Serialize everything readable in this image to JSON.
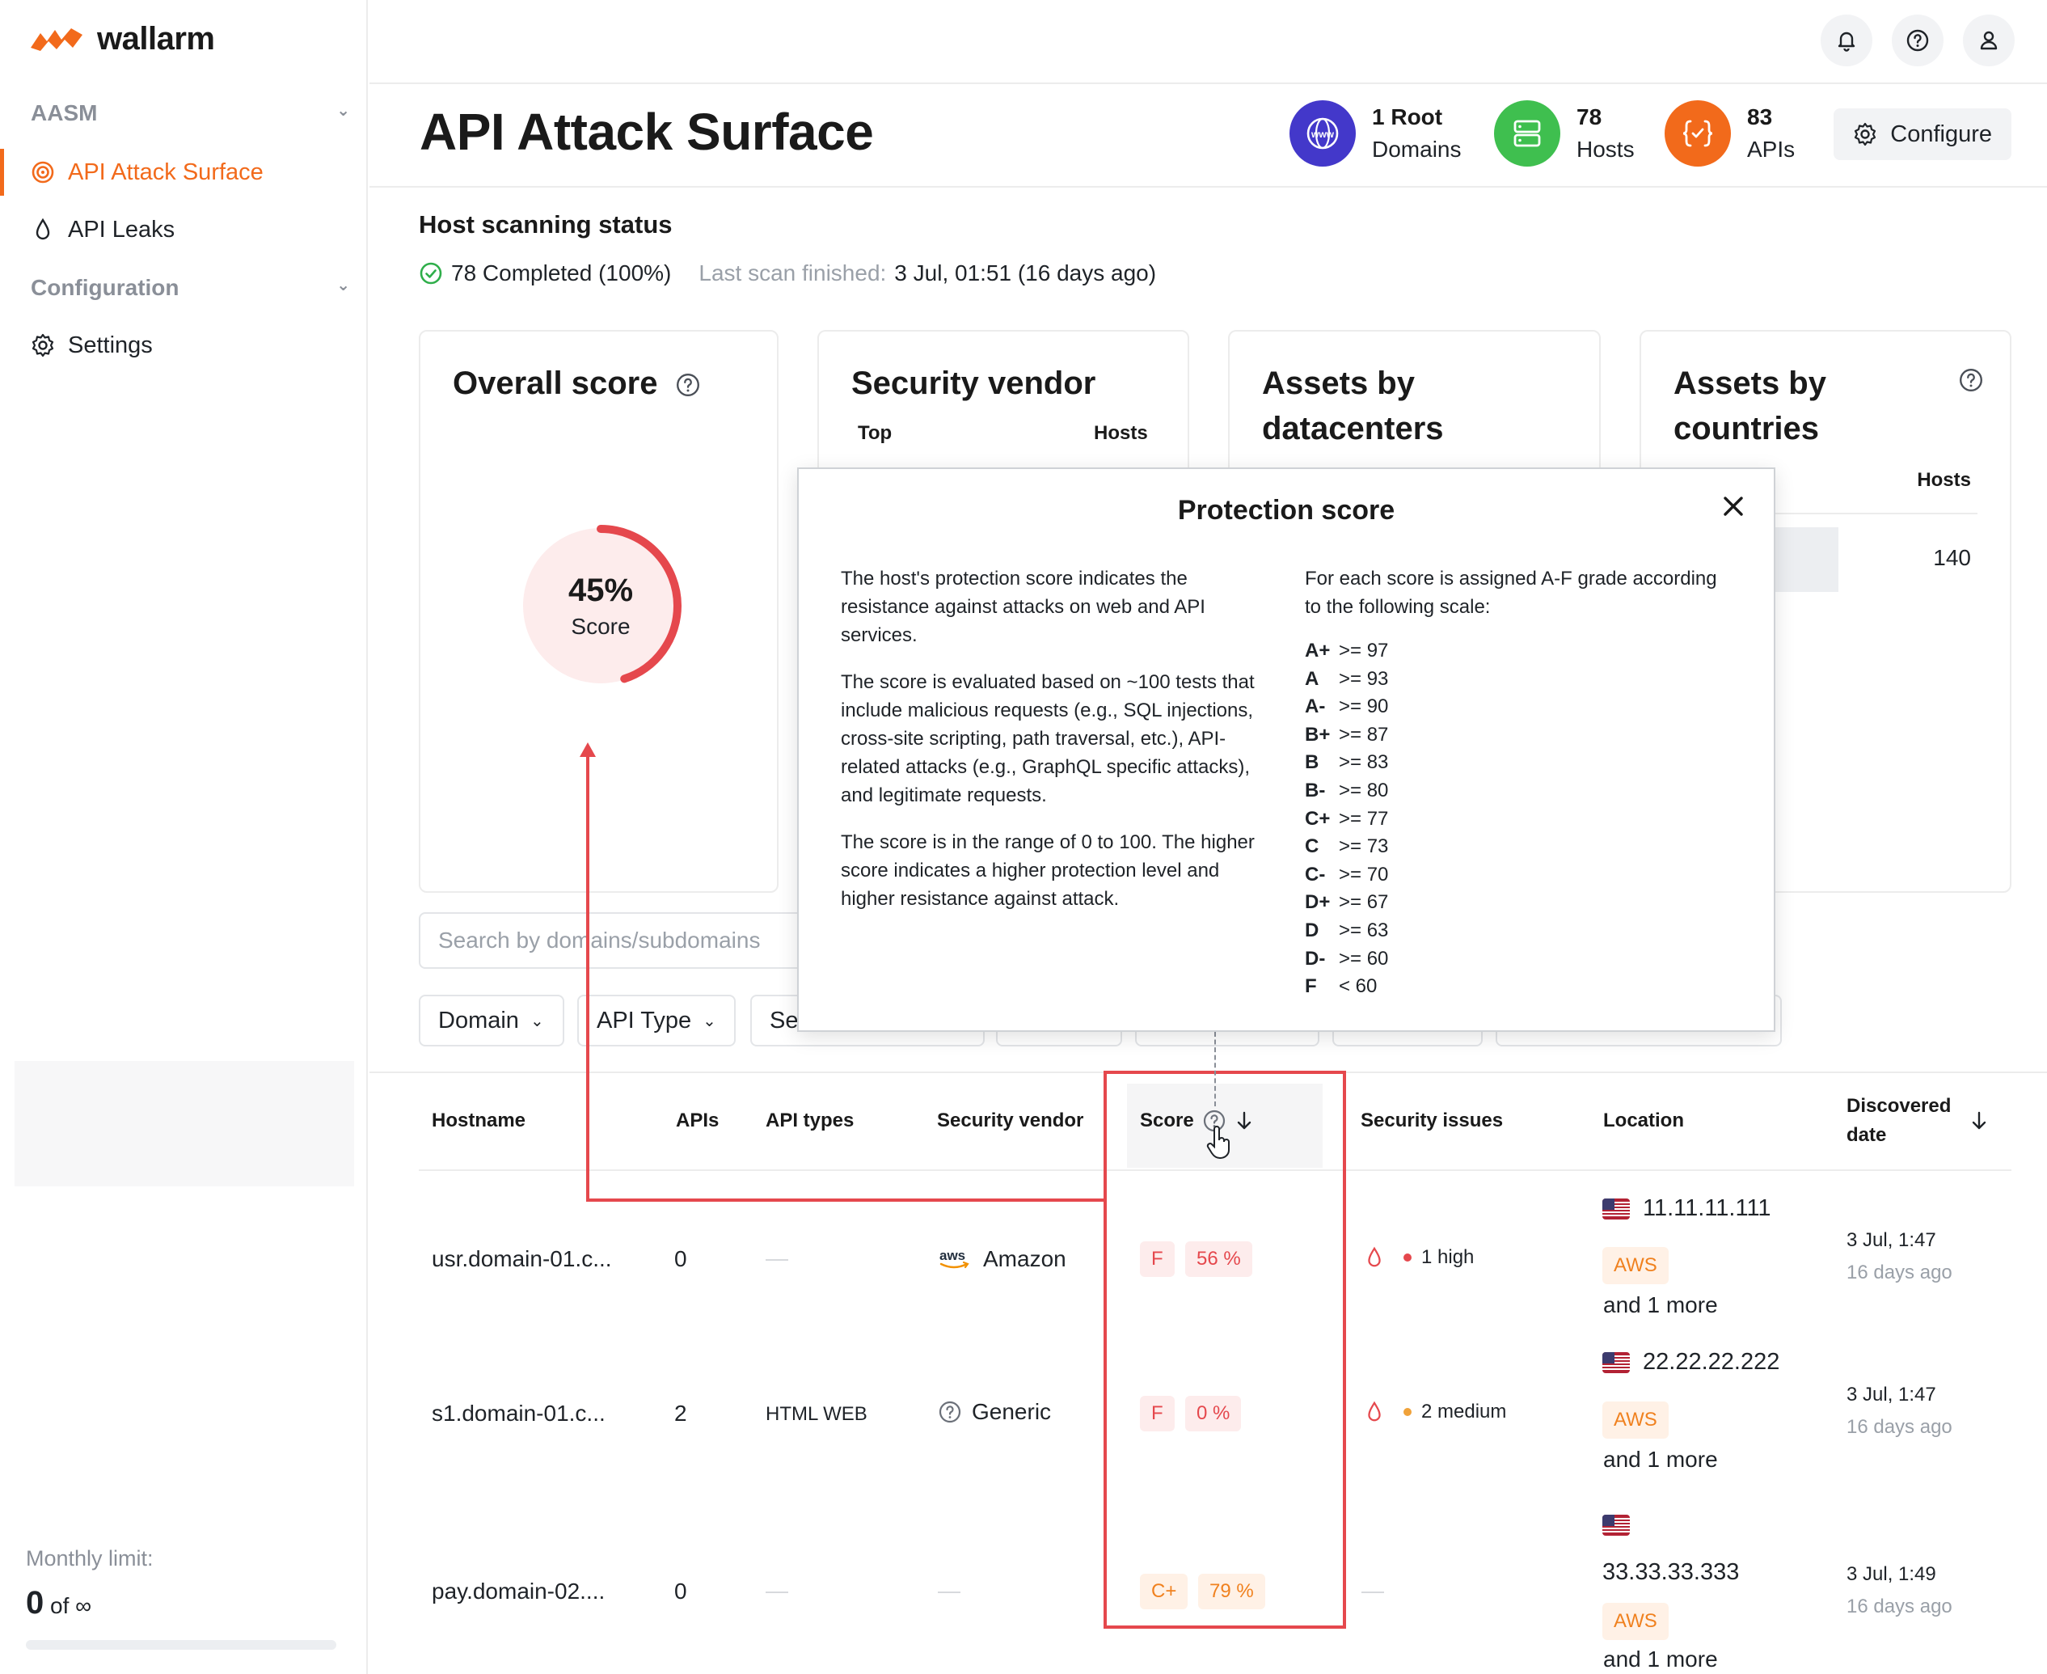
{
  "brand": {
    "name": "wallarm",
    "accent": "#f26a1b"
  },
  "sidebar": {
    "group_aasm": "AASM",
    "items_aasm": [
      {
        "label": "API Attack Surface",
        "icon": "target-icon",
        "active": true
      },
      {
        "label": "API Leaks",
        "icon": "drop-icon",
        "active": false
      }
    ],
    "group_config": "Configuration",
    "items_config": [
      {
        "label": "Settings",
        "icon": "gear-icon"
      }
    ],
    "monthly_limit_label": "Monthly limit:",
    "monthly_limit_value": "0",
    "monthly_limit_of": "of ∞"
  },
  "topbar": {
    "icons": [
      "bell-icon",
      "help-icon",
      "user-icon"
    ]
  },
  "header": {
    "title": "API Attack Surface",
    "stats": [
      {
        "num": "1 Root",
        "label": "Domains",
        "icon": "www-icon",
        "color": "#4338ca"
      },
      {
        "num": "78",
        "label": "Hosts",
        "icon": "server-icon",
        "color": "#3fbf4f"
      },
      {
        "num": "83",
        "label": "APIs",
        "icon": "api-braces-icon",
        "color": "#f26a1b"
      }
    ],
    "configure_label": "Configure"
  },
  "scan": {
    "title": "Host scanning status",
    "completed": "78 Completed (100%)",
    "last_label": "Last scan finished:",
    "last_value": "3 Jul, 01:51 (16 days ago)"
  },
  "cards": {
    "overall_title": "Overall score",
    "overall_value": "45%",
    "overall_label": "Score",
    "overall_fraction": 0.45,
    "vendor_title": "Security vendor",
    "vendor_col_top": "Top",
    "vendor_col_hosts": "Hosts",
    "datacenters_title_1": "Assets by",
    "datacenters_title_2": "datacenters",
    "countries_title_1": "Assets by",
    "countries_title_2": "countries",
    "countries_col_hosts": "Hosts",
    "countries_value": "140"
  },
  "search": {
    "placeholder": "Search by domains/subdomains"
  },
  "filters": [
    {
      "label": "Domain"
    },
    {
      "label": "API Type"
    },
    {
      "label": "Se"
    }
  ],
  "table": {
    "headers": {
      "hostname": "Hostname",
      "apis": "APIs",
      "api_types": "API types",
      "vendor": "Security vendor",
      "score": "Score",
      "issues": "Security issues",
      "location": "Location",
      "discovered_1": "Discovered",
      "discovered_2": "date"
    },
    "rows": [
      {
        "hostname": "usr.domain-01.c...",
        "apis": "0",
        "api_types": "",
        "vendor": "Amazon",
        "vendor_icon": "aws-icon",
        "grade": "F",
        "score": "56 %",
        "issue": "1 high",
        "issue_color": "#e5484d",
        "ip": "11.11.11.111",
        "tag": "AWS",
        "more": "and 1 more",
        "date": "3 Jul, 1:47",
        "ago": "16 days ago"
      },
      {
        "hostname": "s1.domain-01.c...",
        "apis": "2",
        "api_types": "HTML WEB",
        "vendor": "Generic",
        "vendor_icon": "question-circle-icon",
        "grade": "F",
        "score": "0 %",
        "issue": "2 medium",
        "issue_color": "#f0a23a",
        "ip": "22.22.22.222",
        "tag": "AWS",
        "more": "and 1 more",
        "date": "3 Jul, 1:47",
        "ago": "16 days ago"
      },
      {
        "hostname": "pay.domain-02....",
        "apis": "0",
        "api_types": "",
        "vendor": "",
        "grade": "C+",
        "score": "79 %",
        "issue": "",
        "ip": "33.33.33.333",
        "tag": "AWS",
        "more": "and 1 more",
        "date": "3 Jul, 1:49",
        "ago": "16 days ago"
      }
    ]
  },
  "modal": {
    "title": "Protection score",
    "left_p1": "The host's protection score indicates the resistance against attacks on web and API services.",
    "left_p2": "The score is evaluated based on ~100 tests that include malicious requests (e.g., SQL injections, cross-site scripting, path traversal, etc.), API-related attacks (e.g., GraphQL specific attacks), and legitimate requests.",
    "left_p3": "The score is in the range of 0 to 100. The higher score indicates a higher protection level and higher resistance against attack.",
    "right_intro": "For each score is assigned A-F grade according to the following scale:",
    "grades": [
      {
        "g": "A+",
        "v": ">= 97"
      },
      {
        "g": "A",
        "v": ">= 93"
      },
      {
        "g": "A-",
        "v": ">= 90"
      },
      {
        "g": "B+",
        "v": ">= 87"
      },
      {
        "g": "B",
        "v": ">= 83"
      },
      {
        "g": "B-",
        "v": ">= 80"
      },
      {
        "g": "C+",
        "v": ">= 77"
      },
      {
        "g": "C",
        "v": ">= 73"
      },
      {
        "g": "C-",
        "v": ">= 70"
      },
      {
        "g": "D+",
        "v": ">= 67"
      },
      {
        "g": "D",
        "v": ">= 63"
      },
      {
        "g": "D-",
        "v": ">= 60"
      },
      {
        "g": "F",
        "v": "< 60"
      }
    ]
  }
}
